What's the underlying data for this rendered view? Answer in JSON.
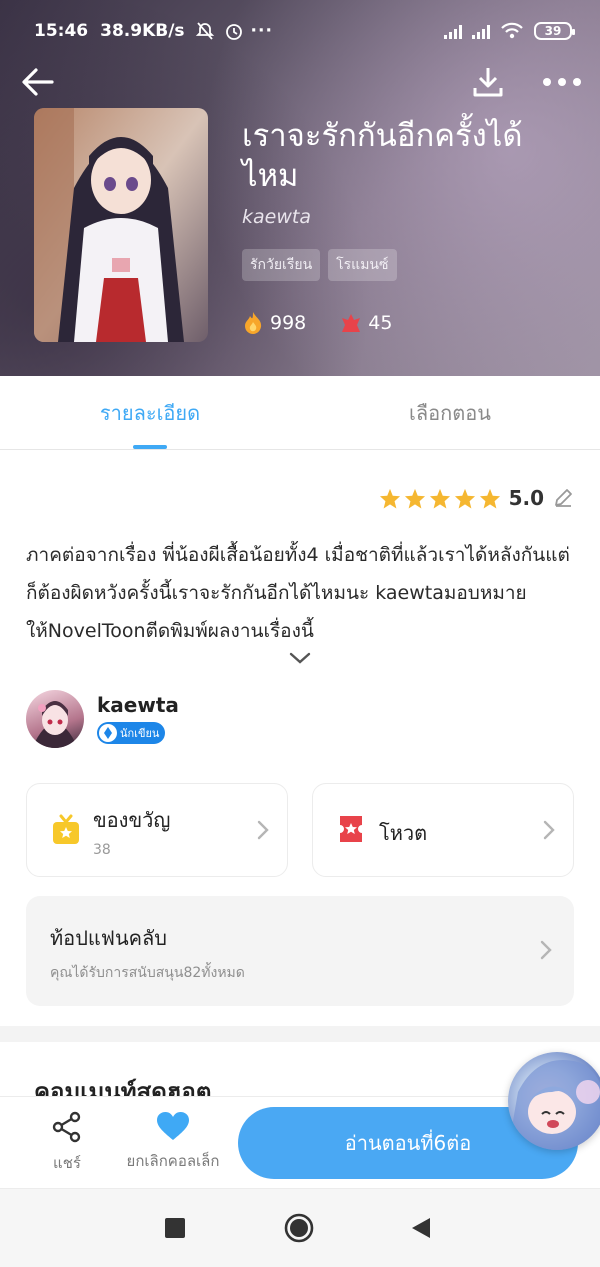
{
  "status_bar": {
    "time": "15:46",
    "net_speed": "38.9KB/s",
    "battery": "39"
  },
  "header": {
    "title": "เราจะรักกันอีกครั้งได้ไหม",
    "author": "kaewta",
    "tags": [
      "รักวัยเรียน",
      "โรแมนซ์"
    ],
    "stats": {
      "fire": "998",
      "votes": "45"
    },
    "icons": {
      "back": "back-arrow-icon",
      "download": "download-icon",
      "more": "more-dots-icon"
    }
  },
  "tabs": [
    {
      "label": "รายละเอียด",
      "active": true
    },
    {
      "label": "เลือกตอน",
      "active": false
    }
  ],
  "rating": {
    "value": "5.0",
    "stars": 5
  },
  "description": "ภาคต่อจากเรื่อง  พี่น้องผีเสื้อน้อยทั้ง4 เมื่อชาติที่แล้วเราได้หลังกันแต่ก็ต้องผิดหวังครั้งนี้เราจะรักกันอีกได้ไหมนะ kaewtaมอบหมายให้NovelToonตีดพิมพ์ผลงานเรื่องนี้",
  "writer": {
    "name": "kaewta",
    "badge": "นักเขียน"
  },
  "cards": {
    "gift": {
      "title": "ของขวัญ",
      "count": "38"
    },
    "vote": {
      "title": "โหวต"
    }
  },
  "fanclub": {
    "title": "ท้อปแฟนคลับ",
    "subtitle": "คุณได้รับการสนับสนุน82ทั้งหมด"
  },
  "comments": {
    "title": "คอมเมนท์สุดฮอต"
  },
  "action_bar": {
    "share": "แชร์",
    "collect": "ยกเลิกคอลเล็ก",
    "read": "อ่านตอนที่6ต่อ"
  },
  "colors": {
    "accent": "#3fa9f5",
    "read_button": "#4aa8f3",
    "star": "#f5b731",
    "badge": "#1d86e8"
  }
}
